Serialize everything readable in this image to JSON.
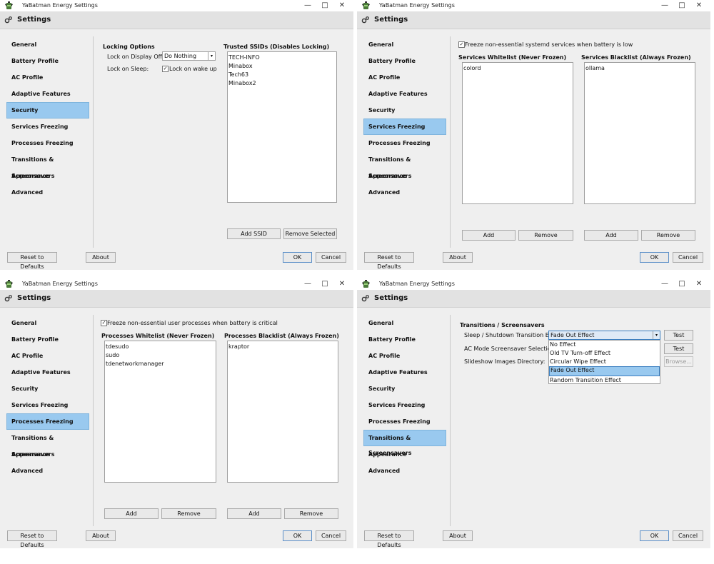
{
  "app": {
    "window_title": "YaBatman Energy Settings",
    "header_title": "Settings",
    "icons": {
      "app": "battery-bat-icon",
      "settings": "gear-icon",
      "minimize": "minimize-icon",
      "maximize": "maximize-icon",
      "close": "close-icon"
    }
  },
  "sidebar": {
    "items": [
      {
        "label": "General"
      },
      {
        "label": "Battery Profile"
      },
      {
        "label": "AC Profile"
      },
      {
        "label": "Adaptive Features"
      },
      {
        "label": "Security"
      },
      {
        "label": "Services Freezing"
      },
      {
        "label": "Processes Freezing"
      },
      {
        "label": "Transitions & Screensavers"
      },
      {
        "label": "Appearance"
      },
      {
        "label": "Advanced"
      }
    ]
  },
  "footer": {
    "reset": "Reset to Defaults",
    "about": "About",
    "ok": "OK",
    "cancel": "Cancel"
  },
  "security": {
    "locking_title": "Locking Options",
    "display_off_label": "Lock on Display Off:",
    "display_off_value": "Do Nothing",
    "sleep_label": "Lock on Sleep:",
    "wake_checkbox": "Lock on wake up",
    "ssid_title": "Trusted SSIDs (Disables Locking)",
    "ssids": [
      "TECH-INFO",
      "Minabox",
      "Tech63",
      "Minabox2"
    ],
    "add_ssid": "Add SSID",
    "remove_selected": "Remove Selected"
  },
  "services": {
    "freeze_checkbox": "Freeze non-essential systemd services when battery is low",
    "whitelist_title": "Services Whitelist (Never Frozen)",
    "blacklist_title": "Services Blacklist (Always Frozen)",
    "whitelist": [
      "colord"
    ],
    "blacklist": [
      "ollama"
    ],
    "add": "Add",
    "remove": "Remove"
  },
  "processes": {
    "freeze_checkbox": "Freeze non-essential user processes when battery is critical",
    "whitelist_title": "Processes Whitelist (Never Frozen)",
    "blacklist_title": "Processes Blacklist (Always Frozen)",
    "whitelist": [
      "tdesudo",
      "sudo",
      "tdenetworkmanager"
    ],
    "blacklist": [
      "kraptor"
    ],
    "add": "Add",
    "remove": "Remove"
  },
  "transitions": {
    "title": "Transitions / Screensavers",
    "sleep_label": "Sleep / Shutdown Transition Effect:",
    "sleep_value": "Fade Out Effect",
    "ac_label": "AC Mode Screensaver Selection:",
    "slideshow_label": "Slideshow Images Directory:",
    "test": "Test",
    "browse": "Browse...",
    "options": [
      "No Effect",
      "Old TV Turn-off Effect",
      "Circular Wipe Effect",
      "Fade Out Effect",
      "Random Transition Effect"
    ],
    "selected_option": "Fade Out Effect"
  }
}
